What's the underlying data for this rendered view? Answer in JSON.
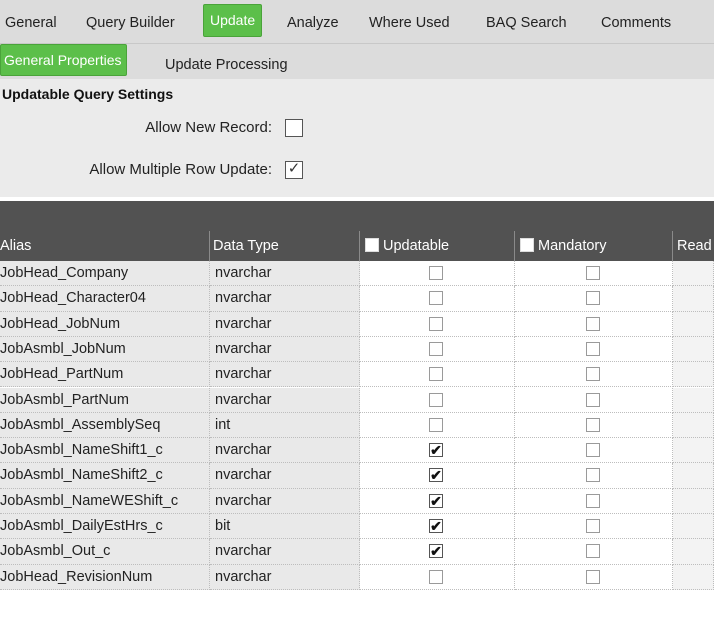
{
  "tabs": [
    "General",
    "Query Builder",
    "Update",
    "Analyze",
    "Where Used",
    "BAQ Search",
    "Comments"
  ],
  "active_tab": "Update",
  "subtabs": [
    "General Properties",
    "Update Processing"
  ],
  "active_subtab": "General Properties",
  "settings": {
    "title": "Updatable Query Settings",
    "allow_new_record_label": "Allow New Record:",
    "allow_new_record": false,
    "allow_multiple_row_update_label": "Allow Multiple Row Update:",
    "allow_multiple_row_update": true
  },
  "grid": {
    "columns": [
      "Alias",
      "Data Type",
      "Updatable",
      "Mandatory",
      "Read"
    ],
    "rows": [
      {
        "alias": "JobHead_Company",
        "type": "nvarchar",
        "updatable": false,
        "mandatory": false
      },
      {
        "alias": "JobHead_Character04",
        "type": "nvarchar",
        "updatable": false,
        "mandatory": false
      },
      {
        "alias": "JobHead_JobNum",
        "type": "nvarchar",
        "updatable": false,
        "mandatory": false
      },
      {
        "alias": "JobAsmbl_JobNum",
        "type": "nvarchar",
        "updatable": false,
        "mandatory": false
      },
      {
        "alias": "JobHead_PartNum",
        "type": "nvarchar",
        "updatable": false,
        "mandatory": false
      },
      {
        "alias": "JobAsmbl_PartNum",
        "type": "nvarchar",
        "updatable": false,
        "mandatory": false
      },
      {
        "alias": "JobAsmbl_AssemblySeq",
        "type": "int",
        "updatable": false,
        "mandatory": false
      },
      {
        "alias": "JobAsmbl_NameShift1_c",
        "type": "nvarchar",
        "updatable": true,
        "mandatory": false
      },
      {
        "alias": "JobAsmbl_NameShift2_c",
        "type": "nvarchar",
        "updatable": true,
        "mandatory": false
      },
      {
        "alias": "JobAsmbl_NameWEShift_c",
        "type": "nvarchar",
        "updatable": true,
        "mandatory": false
      },
      {
        "alias": "JobAsmbl_DailyEstHrs_c",
        "type": "bit",
        "updatable": true,
        "mandatory": false
      },
      {
        "alias": "JobAsmbl_Out_c",
        "type": "nvarchar",
        "updatable": true,
        "mandatory": false
      },
      {
        "alias": "JobHead_RevisionNum",
        "type": "nvarchar",
        "updatable": false,
        "mandatory": false
      }
    ]
  },
  "colors": {
    "active_tab": "#5cbf4a",
    "grid_header": "#525252",
    "panel_bg": "#ebebeb"
  }
}
